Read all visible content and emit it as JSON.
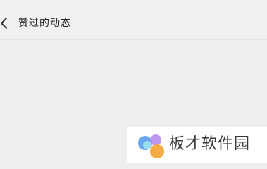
{
  "nav": {
    "back_icon": "chevron-left-icon",
    "title": "赞过的动态"
  },
  "watermark": {
    "text": "板才软件园",
    "logo_colors": [
      "#5b9df0",
      "#b78cf2",
      "#9fe0f0",
      "#f2a63a"
    ]
  },
  "colors": {
    "background": "#eeeeee",
    "nav_background": "#f0f0f0",
    "title_text": "#222222"
  }
}
